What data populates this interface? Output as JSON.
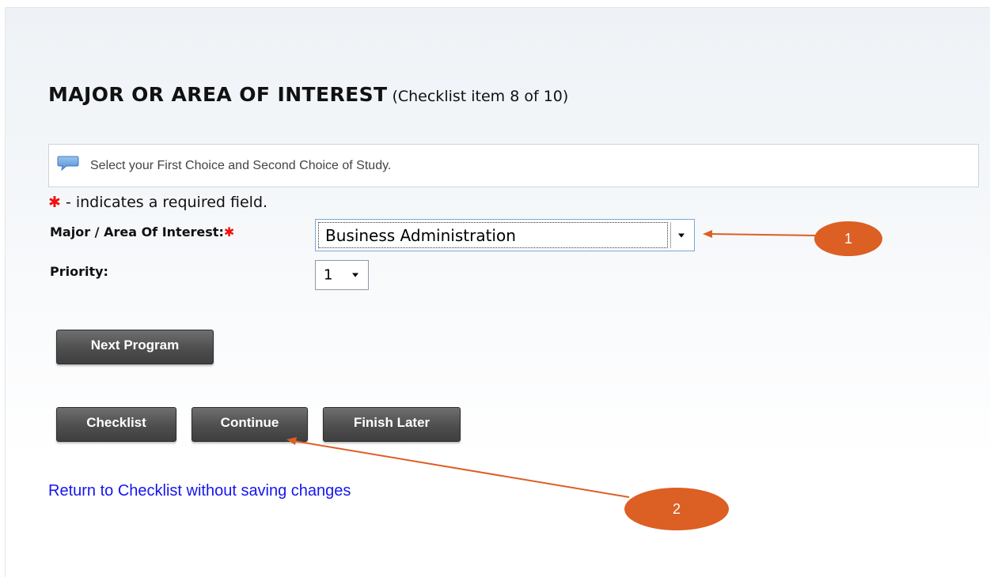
{
  "header": {
    "title": "MAJOR OR AREA OF INTEREST",
    "subtitle": "(Checklist item 8 of 10)"
  },
  "info": {
    "icon": "speech-bubble-icon",
    "text": "Select your First Choice and Second Choice of Study."
  },
  "required_note": {
    "star": "✱",
    "text": "- indicates a required field."
  },
  "form": {
    "major_label": "Major / Area Of Interest:",
    "major_required_star": "✱",
    "major_value": "Business Administration",
    "priority_label": "Priority:",
    "priority_value": "1"
  },
  "buttons": {
    "next_program": "Next Program",
    "checklist": "Checklist",
    "continue": "Continue",
    "finish_later": "Finish Later"
  },
  "link": {
    "return": "Return to Checklist without saving changes"
  },
  "annotations": {
    "callout_1": "1",
    "callout_2": "2"
  },
  "colors": {
    "required_star": "#ee1111",
    "link": "#1515f0",
    "callout": "#dc5f24",
    "button": "#4e4e4e"
  }
}
